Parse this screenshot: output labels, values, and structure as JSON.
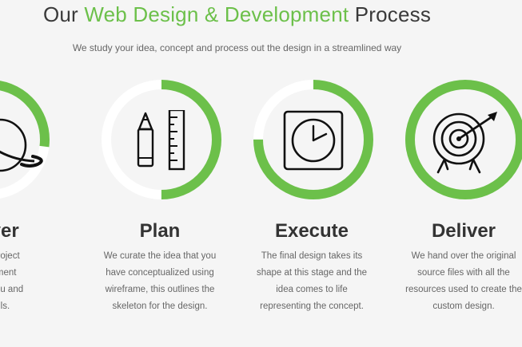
{
  "header": {
    "title_prefix": "Our",
    "title_accent": "Web Design & Development",
    "title_suffix": "Process",
    "subtitle": "We study your idea, concept and process out the design in a streamlined way"
  },
  "colors": {
    "accent": "#6cc04a",
    "ring_track": "#ffffff",
    "heading": "#3a3a3a",
    "body_text": "#666666"
  },
  "steps": [
    {
      "title": "scover",
      "icon": "planet-icon",
      "progress": 0.27,
      "desc_lines": [
        "tand the project",
        "d requirement",
        "sely with you and",
        "wn details."
      ]
    },
    {
      "title": "Plan",
      "icon": "pencil-ruler-icon",
      "progress": 0.5,
      "desc_lines": [
        "We curate the idea that you",
        "have conceptualized using",
        "wireframe, this outlines the",
        "skeleton for the design."
      ]
    },
    {
      "title": "Execute",
      "icon": "clock-icon",
      "progress": 0.75,
      "desc_lines": [
        "The final design takes its",
        "shape at this stage and the",
        "idea comes to life",
        "representing the concept."
      ]
    },
    {
      "title": "Deliver",
      "icon": "target-icon",
      "progress": 1.0,
      "desc_lines": [
        "We hand over the original",
        "source files with all the",
        "resources used to create the",
        "custom design."
      ]
    }
  ]
}
